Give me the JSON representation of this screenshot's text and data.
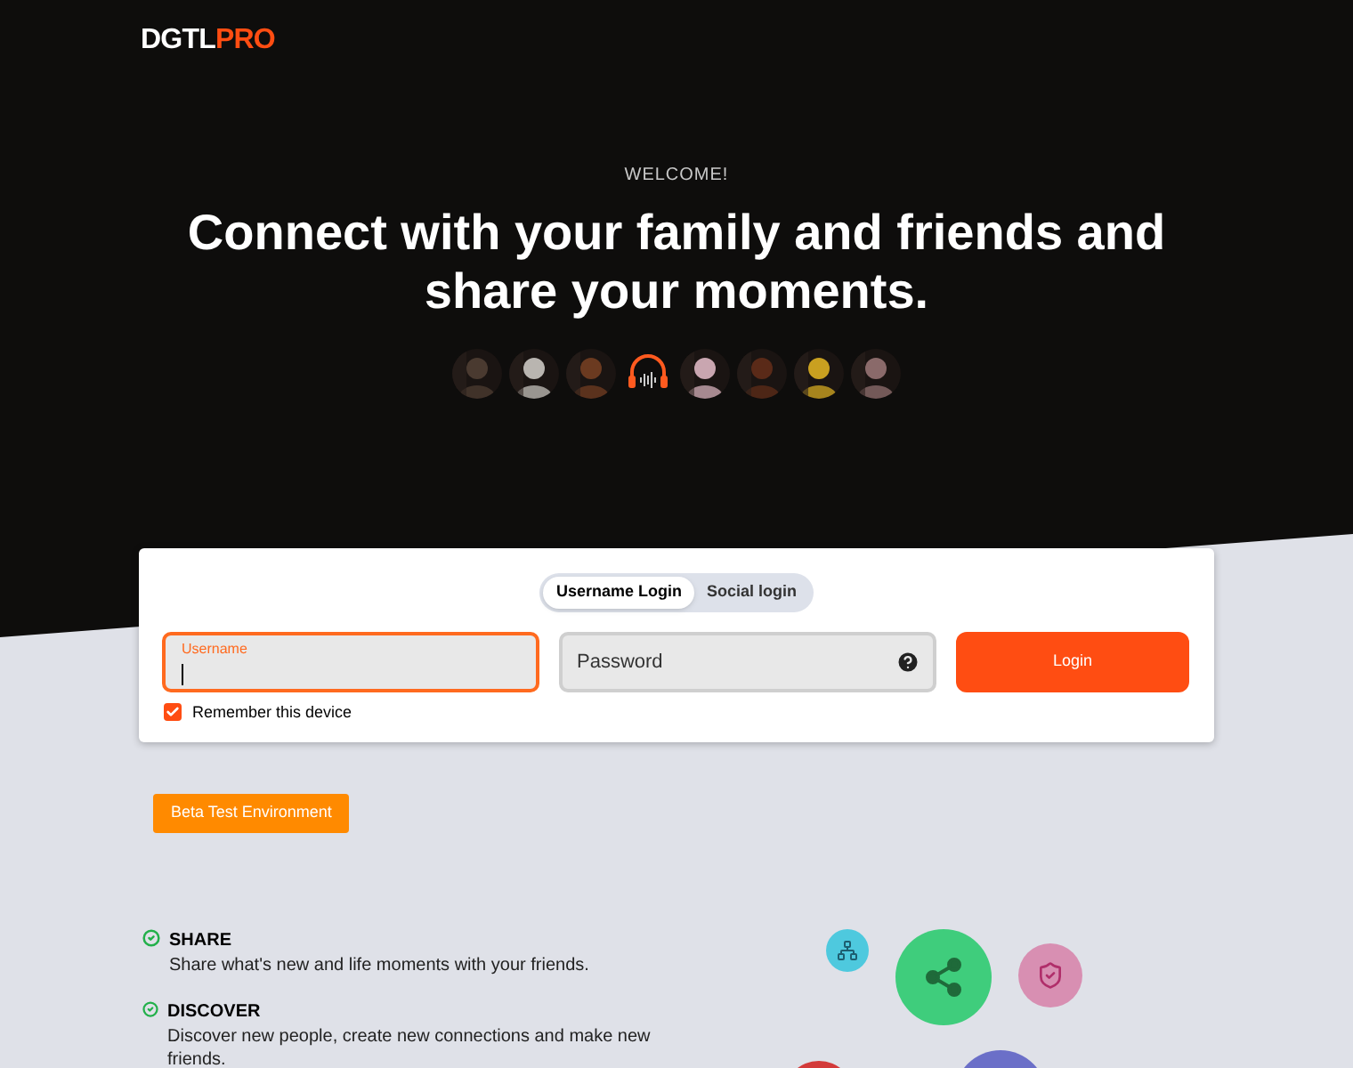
{
  "logo": {
    "first": "DGTL",
    "second": "PRO"
  },
  "hero": {
    "eyebrow": "WELCOME!",
    "headline": "Connect with your family and friends and share your moments."
  },
  "avatars": [
    {
      "kind": "picture"
    },
    {
      "kind": "picture"
    },
    {
      "kind": "picture"
    },
    {
      "kind": "icon"
    },
    {
      "kind": "picture"
    },
    {
      "kind": "picture"
    },
    {
      "kind": "picture"
    },
    {
      "kind": "picture"
    }
  ],
  "login": {
    "tabs": [
      {
        "label": "Username Login",
        "selected": true
      },
      {
        "label": "Social login",
        "selected": false
      }
    ],
    "username": {
      "label": "Username",
      "focused": true
    },
    "password": {
      "placeholder": "Password"
    },
    "button": "Login",
    "remember": {
      "label": "Remember this device",
      "checked": true
    }
  },
  "badge": "Beta Test Environment",
  "features": [
    {
      "title": "SHARE",
      "text": "Share what's new and life moments with your friends."
    },
    {
      "title": "DISCOVER",
      "text": "Discover new people, create new connections and make new friends."
    }
  ]
}
